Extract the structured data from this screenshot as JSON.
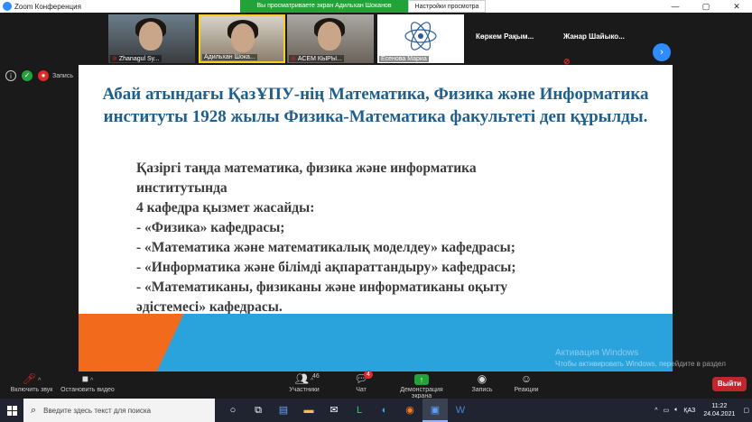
{
  "window": {
    "title": "Zoom Конференция",
    "share_status": "Вы просматриваете экран Адильхан Шоканов",
    "view_options": "Настройки просмотра ⌄",
    "controls": [
      "—",
      "▢",
      "✕"
    ]
  },
  "gallery": {
    "participants": [
      {
        "name": "Zhanagul Sy...",
        "muted": true
      },
      {
        "name": "Адильхан Шока...",
        "muted": false
      },
      {
        "name": "АСЕМ КЫРЫ...",
        "muted": true
      },
      {
        "name": "Есенова Мариа",
        "muted": false
      }
    ],
    "text_participants": [
      {
        "name": "Көркем Рақым...",
        "muted": false
      },
      {
        "name": "Жанар Шайыко...",
        "muted": true
      }
    ],
    "next_icon": "›"
  },
  "meeting_info": {
    "info_icon": "i",
    "security_icon": "✓",
    "record_icon": "●",
    "record_label": "Запись"
  },
  "slide": {
    "heading": "Абай атындағы ҚазҰПУ-нің  Математика, Физика және Информатика институты 1928 жылы Физика-Математика факультеті деп құрылды.",
    "lines": [
      "Қазіргі таңда математика, физика және информатика",
      "институтында",
      "4 кафедра қызмет жасайды:",
      "- «Физика» кафедрасы;",
      "- «Математика және математикалық моделдеу» кафедрасы;",
      "- «Информатика және білімді ақпараттандыру» кафедрасы;",
      "- «Математиканы, физиканы және информатиканы оқыту",
      "әдістемесі» кафедрасы."
    ],
    "colors": {
      "heading": "#1f5f8e",
      "stripe_blue": "#2aa3dd",
      "stripe_orange": "#f26b1d"
    }
  },
  "activation": {
    "title": "Активация Windows",
    "text": "Чтобы активировать Windows, перейдите в раздел \"Параметры\"."
  },
  "toolbar": {
    "mute_label": "Включить звук",
    "video_label": "Остановить видео",
    "participants_label": "Участники",
    "participants_count": "46",
    "chat_label": "Чат",
    "chat_badge": "4",
    "share_label": "Демонстрация экрана",
    "record_label": "Запись",
    "reactions_label": "Реакции",
    "leave_label": "Выйти",
    "share_color": "#22a33a",
    "leave_color": "#c0272d"
  },
  "taskbar": {
    "search_placeholder": "Введите здесь текст для поиска",
    "language": "ҚАЗ",
    "time": "11:22",
    "date": "24.04.2021"
  }
}
